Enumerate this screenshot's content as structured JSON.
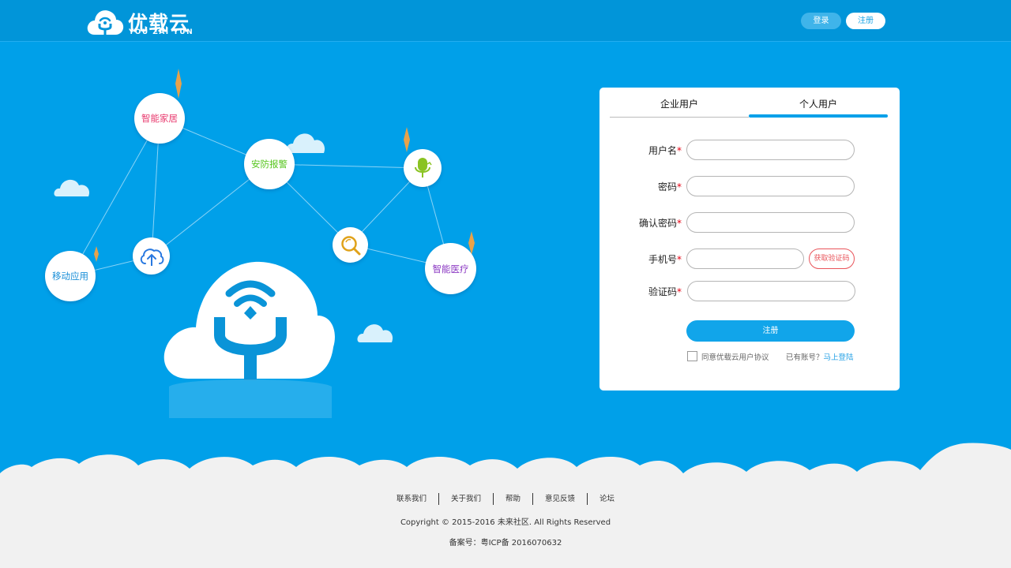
{
  "header": {
    "logo_cn": "优载云",
    "logo_en": "YOU ZAI YUN",
    "login_label": "登录",
    "register_label": "注册"
  },
  "illustration": {
    "nodes": {
      "smart_home": "智能家居",
      "security_alarm": "安防报警",
      "mobile_app": "移动应用",
      "smart_medical": "智能医疗"
    },
    "icons": [
      "cloud-upload-icon",
      "search-icon",
      "microphone-icon",
      "cloud-wifi-logo-icon"
    ]
  },
  "form": {
    "tabs": [
      {
        "label": "企业用户",
        "active": false
      },
      {
        "label": "个人用户",
        "active": true
      }
    ],
    "fields": {
      "username": {
        "label": "用户名",
        "required_mark": "*",
        "value": "",
        "placeholder": ""
      },
      "password": {
        "label": "密码",
        "required_mark": "*",
        "value": "",
        "placeholder": ""
      },
      "confirm_password": {
        "label": "确认密码",
        "required_mark": "*",
        "value": "",
        "placeholder": ""
      },
      "phone": {
        "label": "手机号",
        "required_mark": "*",
        "value": "",
        "placeholder": ""
      },
      "code": {
        "label": "验证码",
        "required_mark": "*",
        "value": "",
        "placeholder": ""
      }
    },
    "get_code_label": "获取验证码",
    "submit_label": "注册",
    "agree_text": "同意优载云用户协议",
    "agree_checked": false,
    "has_account_text": "已有账号？",
    "login_link": "马上登陆"
  },
  "footer": {
    "links": [
      "联系我们",
      "关于我们",
      "帮助",
      "意见反馈",
      "论坛"
    ],
    "copyright": "Copyright © 2015-2016 未来社区. All Rights Reserved",
    "icp": "备案号：粤ICP备 2016070632"
  },
  "colors": {
    "background": "#00a0e9",
    "header": "#0195d9",
    "accent": "#11a5ea",
    "required": "#e60012",
    "get_code": "#e9545a",
    "smart_home_text": "#e8386d",
    "security_text": "#55c51c",
    "mobile_app_text": "#1a8fd8",
    "medical_text": "#8a37c2",
    "footer_bg": "#f1f1f1"
  }
}
